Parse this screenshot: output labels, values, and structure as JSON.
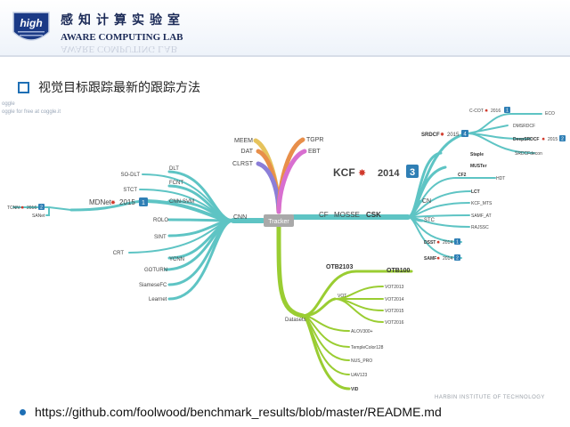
{
  "header": {
    "logo_text": "high",
    "lab_cn": "感知计算实验室",
    "lab_en": "AWARE COMPUTING LAB",
    "lab_en_reflection": "AWARE COMPUTING LAB"
  },
  "slide": {
    "title": "视觉目标跟踪最新的跟踪方法",
    "url": "https://github.com/foolwood/benchmark_results/blob/master/README.md",
    "footer_org": "HARBIN INSTITUTE OF TECHNOLOGY"
  },
  "mindmap": {
    "watermark_line1": "oggle",
    "watermark_line2": "oggle for free at coggle.it",
    "root": "Tracker",
    "top": {
      "meem": "MEEM",
      "dat": "DAT",
      "clrst": "CLRST",
      "tgpr": "TGPR",
      "ebt": "EBT"
    },
    "cnn": {
      "label": "CNN",
      "items": {
        "sodlt": "SO-DLT",
        "dlt": "DLT",
        "fcnt": "FCNT",
        "stct": "STCT",
        "cnnsvm": "CNN-SVM",
        "rolo": "ROLO",
        "sint": "SINT",
        "crt": "CRT",
        "ycnn": "YCNN",
        "goturn": "GOTURN",
        "siamese": "SiameseFC",
        "learnet": "Learnet"
      },
      "mdnet": "MDNet",
      "mdnet_year": "2015",
      "mdnet_badge": "1",
      "tcnn": "TCNN",
      "tcnn_year": "2016",
      "tcnn_badge": "2",
      "sanet": "SANet"
    },
    "cf": {
      "label": "CF",
      "mosse": "MOSSE",
      "csk": "CSK",
      "kcf": "KCF",
      "kcf_year": "2014",
      "kcf_badge": "3",
      "ccot": "C-COT",
      "ccot_year": "2016",
      "ccot_badge": "1",
      "eco": "ECO",
      "srdcf": "SRDCF",
      "srdcf_year": "2015",
      "srdcf_badge": "4",
      "dmsrdcf": "DMSRDCF",
      "deepsrdcf": "DeepSRDCF",
      "deepsrdcf_year": "2015",
      "deepsrdcf_badge": "2",
      "srdcfdecon": "SRDCFdecon",
      "staple": "Staple",
      "muster": "MUSTer",
      "cf2": "CF2",
      "hdt": "HDT",
      "lct": "LCT",
      "kcfmts": "KCF_MTS",
      "samfat": "SAMF_AT",
      "rajssc": "RAJSSC",
      "cn": "CN",
      "stc": "STC",
      "dsst": "DSST",
      "dsst_year": "2014",
      "dsst_badge": "1",
      "samf": "SAMF",
      "samf_year": "2014",
      "samf_badge": "2"
    },
    "datasets": {
      "label": "Datasets",
      "otb2103": "OTB2103",
      "otb100": "OTB100",
      "vot": "VOT",
      "vot2013": "VOT2013",
      "vot2014": "VOT2014",
      "vot2015": "VOT2015",
      "vot2016": "VOT2016",
      "alov": "ALOV300+",
      "tc128": "TempleColor128",
      "nus": "NUS_PRO",
      "uav": "UAV123",
      "vid": "VID"
    },
    "colors": {
      "cnn": "#5ec4c4",
      "cf": "#5ec4c4",
      "datasets": "#9acd32",
      "meem": "#e6c35c",
      "dat": "#e88f4a",
      "clrst": "#8b7ed8",
      "tgpr": "#e88f4a",
      "ebt": "#d86fd0",
      "badge": "#2f7fb5",
      "root": "#a9a9a9"
    }
  }
}
